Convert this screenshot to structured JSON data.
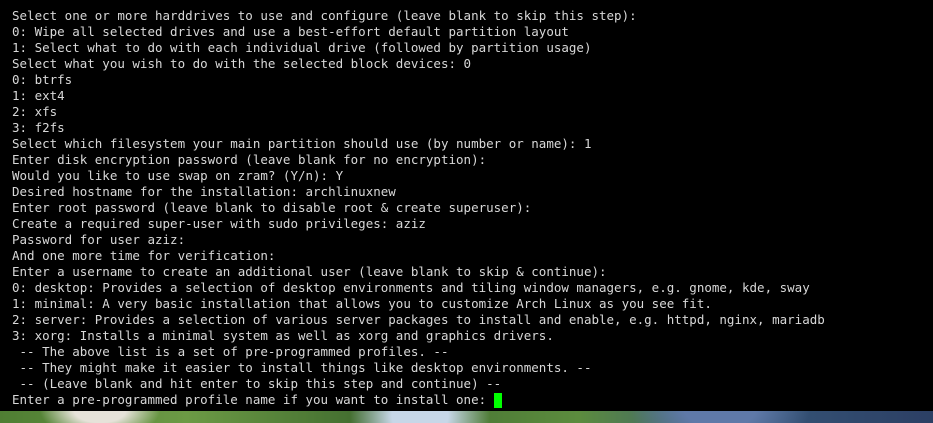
{
  "terminal": {
    "lines": [
      "Select one or more harddrives to use and configure (leave blank to skip this step):",
      "0: Wipe all selected drives and use a best-effort default partition layout",
      "1: Select what to do with each individual drive (followed by partition usage)",
      "Select what you wish to do with the selected block devices: 0",
      "0: btrfs",
      "1: ext4",
      "2: xfs",
      "3: f2fs",
      "Select which filesystem your main partition should use (by number or name): 1",
      "Enter disk encryption password (leave blank for no encryption):",
      "Would you like to use swap on zram? (Y/n): Y",
      "Desired hostname for the installation: archlinuxnew",
      "Enter root password (leave blank to disable root & create superuser):",
      "Create a required super-user with sudo privileges: aziz",
      "Password for user aziz:",
      "And one more time for verification:",
      "Enter a username to create an additional user (leave blank to skip & continue):",
      "0: desktop: Provides a selection of desktop environments and tiling window managers, e.g. gnome, kde, sway",
      "1: minimal: A very basic installation that allows you to customize Arch Linux as you see fit.",
      "2: server: Provides a selection of various server packages to install and enable, e.g. httpd, nginx, mariadb",
      "3: xorg: Installs a minimal system as well as xorg and graphics drivers.",
      " -- The above list is a set of pre-programmed profiles. --",
      " -- They might make it easier to install things like desktop environments. --",
      " -- (Leave blank and hit enter to skip this step and continue) --"
    ],
    "prompt": "Enter a pre-programmed profile name if you want to install one: ",
    "input_value": "",
    "cursor_color": "#00ff00",
    "background_color": "#000000",
    "text_color": "#d8d8d8"
  }
}
